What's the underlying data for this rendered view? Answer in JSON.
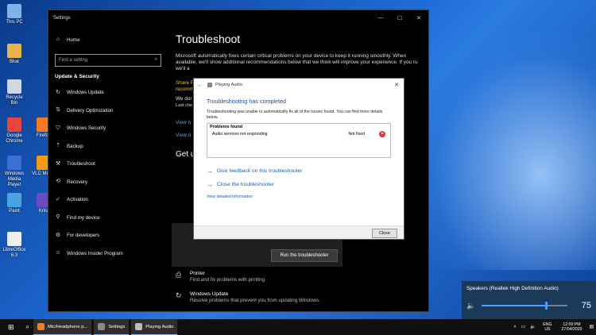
{
  "desktop": {
    "icons": [
      {
        "label": "This PC",
        "color": "#7fb2e8"
      },
      {
        "label": "Blue",
        "color": "#e6b44c"
      },
      {
        "label": "Recycle Bin",
        "color": "#cfd8e3"
      },
      {
        "label": "Google Chrome",
        "color": "#e8453c"
      },
      {
        "label": "Firefox",
        "color": "#f47b20"
      },
      {
        "label": "Windows Media Player",
        "color": "#3b6fd6"
      },
      {
        "label": "VLC Media",
        "color": "#f39c12"
      },
      {
        "label": "Paint",
        "color": "#4aa3df"
      },
      {
        "label": "Krita",
        "color": "#6a4cc0"
      },
      {
        "label": "LibreOffice 6.3",
        "color": "#eeeeee"
      }
    ]
  },
  "settings": {
    "window_title": "Settings",
    "sidebar": {
      "home": "Home",
      "search_placeholder": "Find a setting",
      "section": "Update & Security",
      "items": [
        {
          "label": "Windows Update",
          "icon": "sync-icon"
        },
        {
          "label": "Delivery Optimization",
          "icon": "delivery-icon"
        },
        {
          "label": "Windows Security",
          "icon": "shield-icon"
        },
        {
          "label": "Backup",
          "icon": "backup-icon"
        },
        {
          "label": "Troubleshoot",
          "icon": "wrench-icon"
        },
        {
          "label": "Recovery",
          "icon": "recovery-icon"
        },
        {
          "label": "Activation",
          "icon": "activation-icon"
        },
        {
          "label": "Find my device",
          "icon": "person-icon"
        },
        {
          "label": "For developers",
          "icon": "developer-icon"
        },
        {
          "label": "Windows Insider Program",
          "icon": "insider-icon"
        }
      ]
    },
    "main": {
      "title": "Troubleshoot",
      "intro": "Microsoft automatically fixes certain critical problems on your device to keep it running smoothly. When available, we'll show additional recommendations below that we think will improve your experience. If you ru",
      "partial_1": "we'll a",
      "share": "Share F",
      "recomm": "recomm",
      "we_do": "We dor",
      "last_che": "Last che",
      "view": "View h",
      "view2": "View d",
      "get_up": "Get u",
      "run_button": "Run the troubleshooter",
      "printer_title": "Printer",
      "printer_desc": "Find and fix problems with printing",
      "wu_title": "Windows Update",
      "wu_desc": "Resolve problems that prevent you from updating Windows."
    }
  },
  "dialog": {
    "title": "Playing Audio",
    "heading": "Troubleshooting has completed",
    "message": "Troubleshooting was unable to automatically fix all of the issues found. You can find more details below.",
    "problems_header": "Problems found",
    "problem_name": "Audio services not responding",
    "problem_status": "Not fixed",
    "link_feedback": "Give feedback on this troubleshooter",
    "link_close": "Close the troubleshooter",
    "link_details": "View detailed information",
    "close_button": "Close"
  },
  "volume": {
    "device": "Speakers (Realtek High Definition Audio)",
    "level": "75",
    "fraction": 0.75
  },
  "taskbar": {
    "items": [
      {
        "label": "Mic/Headphone p...",
        "color": "#f47b20"
      },
      {
        "label": "Settings",
        "color": "#888888"
      },
      {
        "label": "Playing Audio",
        "color": "#bbbbbb"
      }
    ],
    "lang_top": "ENG",
    "lang_bottom": "US",
    "time": "12:00 PM",
    "date": "27/04/2020"
  },
  "colors": {
    "accent": "#1a5fb4",
    "error": "#d13438",
    "taskbar_bg": "#101010"
  }
}
